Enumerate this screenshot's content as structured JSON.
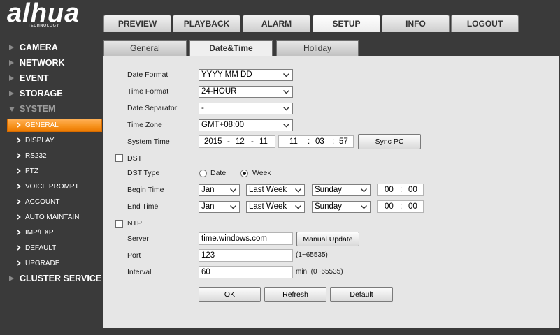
{
  "colors": {
    "background": "#3a3a3a",
    "panel": "#e6e6e6",
    "accent": "#f7931e"
  },
  "logo": {
    "text": "alhua",
    "tagline": "TECHNOLOGY"
  },
  "top_nav": [
    {
      "label": "PREVIEW",
      "active": false
    },
    {
      "label": "PLAYBACK",
      "active": false
    },
    {
      "label": "ALARM",
      "active": false
    },
    {
      "label": "SETUP",
      "active": true
    },
    {
      "label": "INFO",
      "active": false
    },
    {
      "label": "LOGOUT",
      "active": false
    }
  ],
  "sidebar": {
    "menu": [
      {
        "label": "CAMERA",
        "icon": "triangle-right-icon",
        "expanded": false
      },
      {
        "label": "NETWORK",
        "icon": "triangle-right-icon",
        "expanded": false
      },
      {
        "label": "EVENT",
        "icon": "triangle-right-icon",
        "expanded": false
      },
      {
        "label": "STORAGE",
        "icon": "triangle-right-icon",
        "expanded": false
      },
      {
        "label": "SYSTEM",
        "icon": "triangle-down-icon",
        "expanded": true
      },
      {
        "label": "CLUSTER SERVICE",
        "icon": "triangle-right-icon",
        "expanded": false
      }
    ],
    "item_icon": "chevron-right-icon",
    "system_items": [
      {
        "label": "GENERAL",
        "active": true
      },
      {
        "label": "DISPLAY",
        "active": false
      },
      {
        "label": "RS232",
        "active": false
      },
      {
        "label": "PTZ",
        "active": false
      },
      {
        "label": "VOICE PROMPT",
        "active": false
      },
      {
        "label": "ACCOUNT",
        "active": false
      },
      {
        "label": "AUTO MAINTAIN",
        "active": false
      },
      {
        "label": "IMP/EXP",
        "active": false
      },
      {
        "label": "DEFAULT",
        "active": false
      },
      {
        "label": "UPGRADE",
        "active": false
      }
    ]
  },
  "sub_tabs": [
    {
      "label": "General",
      "active": false
    },
    {
      "label": "Date&Time",
      "active": true
    },
    {
      "label": "Holiday",
      "active": false
    }
  ],
  "form": {
    "date_format": {
      "label": "Date Format",
      "value": "YYYY MM DD"
    },
    "time_format": {
      "label": "Time Format",
      "value": "24-HOUR"
    },
    "date_separator": {
      "label": "Date Separator",
      "value": "-"
    },
    "time_zone": {
      "label": "Time Zone",
      "value": "GMT+08:00"
    },
    "system_time": {
      "label": "System Time",
      "year": "2015",
      "month": "12",
      "day": "11",
      "hour": "11",
      "minute": "03",
      "second": "57",
      "date_separator": "-",
      "time_separator": ":",
      "sync_button": "Sync PC"
    },
    "dst": {
      "label": "DST",
      "checked": false
    },
    "dst_type": {
      "label": "DST Type",
      "options": [
        {
          "label": "Date",
          "selected": false
        },
        {
          "label": "Week",
          "selected": true
        }
      ]
    },
    "begin_time": {
      "label": "Begin Time",
      "month": "Jan",
      "week": "Last Week",
      "weekday": "Sunday",
      "hour": "00",
      "minute": "00",
      "separator": ":"
    },
    "end_time": {
      "label": "End Time",
      "month": "Jan",
      "week": "Last Week",
      "weekday": "Sunday",
      "hour": "00",
      "minute": "00",
      "separator": ":"
    },
    "ntp": {
      "label": "NTP",
      "checked": false
    },
    "server": {
      "label": "Server",
      "value": "time.windows.com",
      "button": "Manual Update"
    },
    "port": {
      "label": "Port",
      "value": "123",
      "hint": "(1~65535)"
    },
    "interval": {
      "label": "Interval",
      "value": "60",
      "hint": "min. (0~65535)"
    }
  },
  "actions": {
    "ok": "OK",
    "refresh": "Refresh",
    "default": "Default"
  }
}
